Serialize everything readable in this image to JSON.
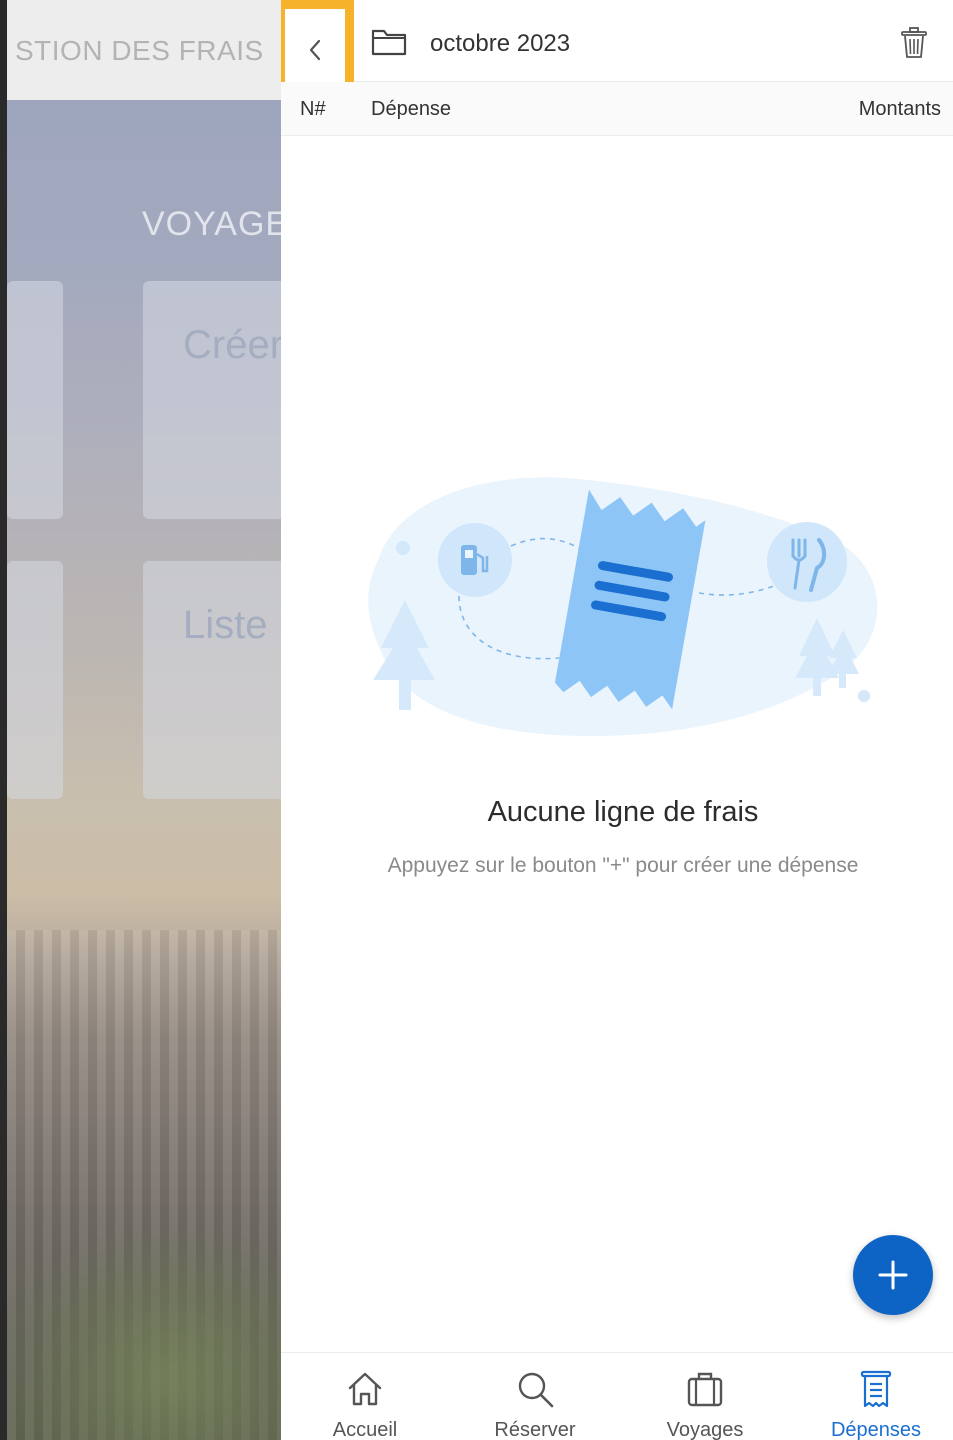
{
  "background": {
    "header_title": "STION DES FRAIS",
    "section_title": "VOYAGE",
    "cards": [
      {
        "label": ""
      },
      {
        "label": "Créer"
      },
      {
        "label": ""
      },
      {
        "label": "Liste"
      }
    ]
  },
  "drawer": {
    "back_icon": "chevron-left-icon",
    "folder_icon": "folder-icon",
    "title": "octobre 2023",
    "trash_icon": "trash-icon",
    "table_header": {
      "number": "N#",
      "expense": "Dépense",
      "amount": "Montants"
    },
    "empty_state": {
      "title": "Aucune ligne de frais",
      "subtitle": "Appuyez sur le bouton \"+\" pour créer une dépense"
    },
    "fab_icon": "plus-icon"
  },
  "bottom_nav": {
    "items": [
      {
        "label": "Accueil",
        "icon": "home-icon",
        "active": false
      },
      {
        "label": "Réserver",
        "icon": "search-icon",
        "active": false
      },
      {
        "label": "Voyages",
        "icon": "suitcase-icon",
        "active": false
      },
      {
        "label": "Dépenses",
        "icon": "receipt-icon",
        "active": true
      }
    ]
  },
  "colors": {
    "accent": "#0e64c4",
    "active_nav": "#1a6fd1",
    "highlight_border": "#f6b22a",
    "illustration_light": "#eaf4fd",
    "illustration_mid": "#cfe6fb",
    "illustration_receipt": "#8ec5f7",
    "illustration_lines": "#1a6fd1"
  }
}
